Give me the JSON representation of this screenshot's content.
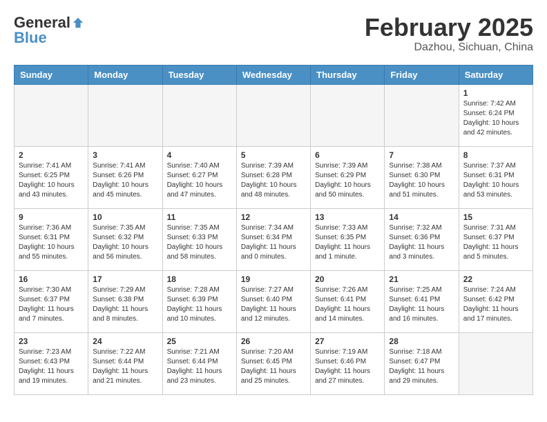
{
  "header": {
    "logo_general": "General",
    "logo_blue": "Blue",
    "month_title": "February 2025",
    "location": "Dazhou, Sichuan, China"
  },
  "weekdays": [
    "Sunday",
    "Monday",
    "Tuesday",
    "Wednesday",
    "Thursday",
    "Friday",
    "Saturday"
  ],
  "weeks": [
    [
      {
        "day": "",
        "info": ""
      },
      {
        "day": "",
        "info": ""
      },
      {
        "day": "",
        "info": ""
      },
      {
        "day": "",
        "info": ""
      },
      {
        "day": "",
        "info": ""
      },
      {
        "day": "",
        "info": ""
      },
      {
        "day": "1",
        "info": "Sunrise: 7:42 AM\nSunset: 6:24 PM\nDaylight: 10 hours\nand 42 minutes."
      }
    ],
    [
      {
        "day": "2",
        "info": "Sunrise: 7:41 AM\nSunset: 6:25 PM\nDaylight: 10 hours\nand 43 minutes."
      },
      {
        "day": "3",
        "info": "Sunrise: 7:41 AM\nSunset: 6:26 PM\nDaylight: 10 hours\nand 45 minutes."
      },
      {
        "day": "4",
        "info": "Sunrise: 7:40 AM\nSunset: 6:27 PM\nDaylight: 10 hours\nand 47 minutes."
      },
      {
        "day": "5",
        "info": "Sunrise: 7:39 AM\nSunset: 6:28 PM\nDaylight: 10 hours\nand 48 minutes."
      },
      {
        "day": "6",
        "info": "Sunrise: 7:39 AM\nSunset: 6:29 PM\nDaylight: 10 hours\nand 50 minutes."
      },
      {
        "day": "7",
        "info": "Sunrise: 7:38 AM\nSunset: 6:30 PM\nDaylight: 10 hours\nand 51 minutes."
      },
      {
        "day": "8",
        "info": "Sunrise: 7:37 AM\nSunset: 6:31 PM\nDaylight: 10 hours\nand 53 minutes."
      }
    ],
    [
      {
        "day": "9",
        "info": "Sunrise: 7:36 AM\nSunset: 6:31 PM\nDaylight: 10 hours\nand 55 minutes."
      },
      {
        "day": "10",
        "info": "Sunrise: 7:35 AM\nSunset: 6:32 PM\nDaylight: 10 hours\nand 56 minutes."
      },
      {
        "day": "11",
        "info": "Sunrise: 7:35 AM\nSunset: 6:33 PM\nDaylight: 10 hours\nand 58 minutes."
      },
      {
        "day": "12",
        "info": "Sunrise: 7:34 AM\nSunset: 6:34 PM\nDaylight: 11 hours\nand 0 minutes."
      },
      {
        "day": "13",
        "info": "Sunrise: 7:33 AM\nSunset: 6:35 PM\nDaylight: 11 hours\nand 1 minute."
      },
      {
        "day": "14",
        "info": "Sunrise: 7:32 AM\nSunset: 6:36 PM\nDaylight: 11 hours\nand 3 minutes."
      },
      {
        "day": "15",
        "info": "Sunrise: 7:31 AM\nSunset: 6:37 PM\nDaylight: 11 hours\nand 5 minutes."
      }
    ],
    [
      {
        "day": "16",
        "info": "Sunrise: 7:30 AM\nSunset: 6:37 PM\nDaylight: 11 hours\nand 7 minutes."
      },
      {
        "day": "17",
        "info": "Sunrise: 7:29 AM\nSunset: 6:38 PM\nDaylight: 11 hours\nand 8 minutes."
      },
      {
        "day": "18",
        "info": "Sunrise: 7:28 AM\nSunset: 6:39 PM\nDaylight: 11 hours\nand 10 minutes."
      },
      {
        "day": "19",
        "info": "Sunrise: 7:27 AM\nSunset: 6:40 PM\nDaylight: 11 hours\nand 12 minutes."
      },
      {
        "day": "20",
        "info": "Sunrise: 7:26 AM\nSunset: 6:41 PM\nDaylight: 11 hours\nand 14 minutes."
      },
      {
        "day": "21",
        "info": "Sunrise: 7:25 AM\nSunset: 6:41 PM\nDaylight: 11 hours\nand 16 minutes."
      },
      {
        "day": "22",
        "info": "Sunrise: 7:24 AM\nSunset: 6:42 PM\nDaylight: 11 hours\nand 17 minutes."
      }
    ],
    [
      {
        "day": "23",
        "info": "Sunrise: 7:23 AM\nSunset: 6:43 PM\nDaylight: 11 hours\nand 19 minutes."
      },
      {
        "day": "24",
        "info": "Sunrise: 7:22 AM\nSunset: 6:44 PM\nDaylight: 11 hours\nand 21 minutes."
      },
      {
        "day": "25",
        "info": "Sunrise: 7:21 AM\nSunset: 6:44 PM\nDaylight: 11 hours\nand 23 minutes."
      },
      {
        "day": "26",
        "info": "Sunrise: 7:20 AM\nSunset: 6:45 PM\nDaylight: 11 hours\nand 25 minutes."
      },
      {
        "day": "27",
        "info": "Sunrise: 7:19 AM\nSunset: 6:46 PM\nDaylight: 11 hours\nand 27 minutes."
      },
      {
        "day": "28",
        "info": "Sunrise: 7:18 AM\nSunset: 6:47 PM\nDaylight: 11 hours\nand 29 minutes."
      },
      {
        "day": "",
        "info": ""
      }
    ]
  ]
}
